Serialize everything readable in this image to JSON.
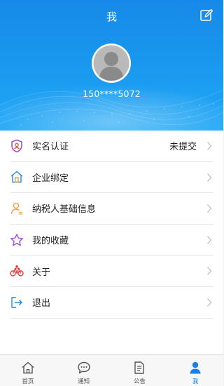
{
  "header": {
    "title": "我",
    "phone": "150****5072"
  },
  "menu": [
    {
      "label": "实名认证",
      "value": "未提交"
    },
    {
      "label": "企业绑定"
    },
    {
      "label": "纳税人基础信息"
    },
    {
      "label": "我的收藏"
    },
    {
      "label": "关于"
    },
    {
      "label": "退出"
    }
  ],
  "tabbar": [
    {
      "label": "首页"
    },
    {
      "label": "通知"
    },
    {
      "label": "公告"
    },
    {
      "label": "我"
    }
  ],
  "colors": {
    "accent": "#1a7fe6",
    "header_top": "#1689e8",
    "header_bottom": "#22a8f5"
  },
  "icons": [
    "edit-icon",
    "shield-user-icon",
    "building-icon",
    "tax-person-icon",
    "star-icon",
    "bicycle-icon",
    "logout-icon",
    "home-icon",
    "chat-icon",
    "document-icon",
    "person-icon"
  ]
}
